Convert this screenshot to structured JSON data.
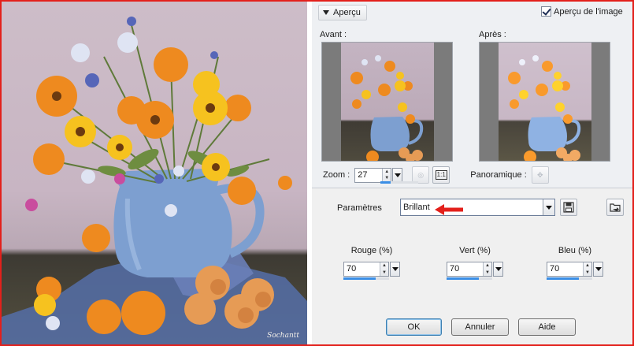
{
  "painting": {
    "signature": "Sochantt"
  },
  "dialog": {
    "preview_header": "Aperçu",
    "image_preview_checkbox": "Aperçu de l'image",
    "image_preview_checked": true,
    "before_label": "Avant :",
    "after_label": "Après :",
    "zoom_label": "Zoom :",
    "zoom_value": "27",
    "zoom_fraction": 0.27,
    "fit_button": "1:1",
    "pan_label": "Panoramique :",
    "params_label": "Paramètres",
    "preset_value": "Brillant",
    "red": {
      "label": "Rouge (%)",
      "value": "70",
      "fraction": 0.7
    },
    "green": {
      "label": "Vert (%)",
      "value": "70",
      "fraction": 0.7
    },
    "blue": {
      "label": "Bleu (%)",
      "value": "70",
      "fraction": 0.7
    },
    "ok_label": "OK",
    "cancel_label": "Annuler",
    "help_label": "Aide"
  },
  "colors": {
    "frame_border": "#e3201b",
    "accent_blue": "#3a8ee6",
    "annotation_arrow": "#e3201b"
  },
  "icons": [
    "chevron-down-icon",
    "checkbox-icon",
    "reset-zoom-icon",
    "fit-icon",
    "pan-icon",
    "save-preset-icon",
    "load-preset-icon",
    "red-arrow-icon"
  ]
}
